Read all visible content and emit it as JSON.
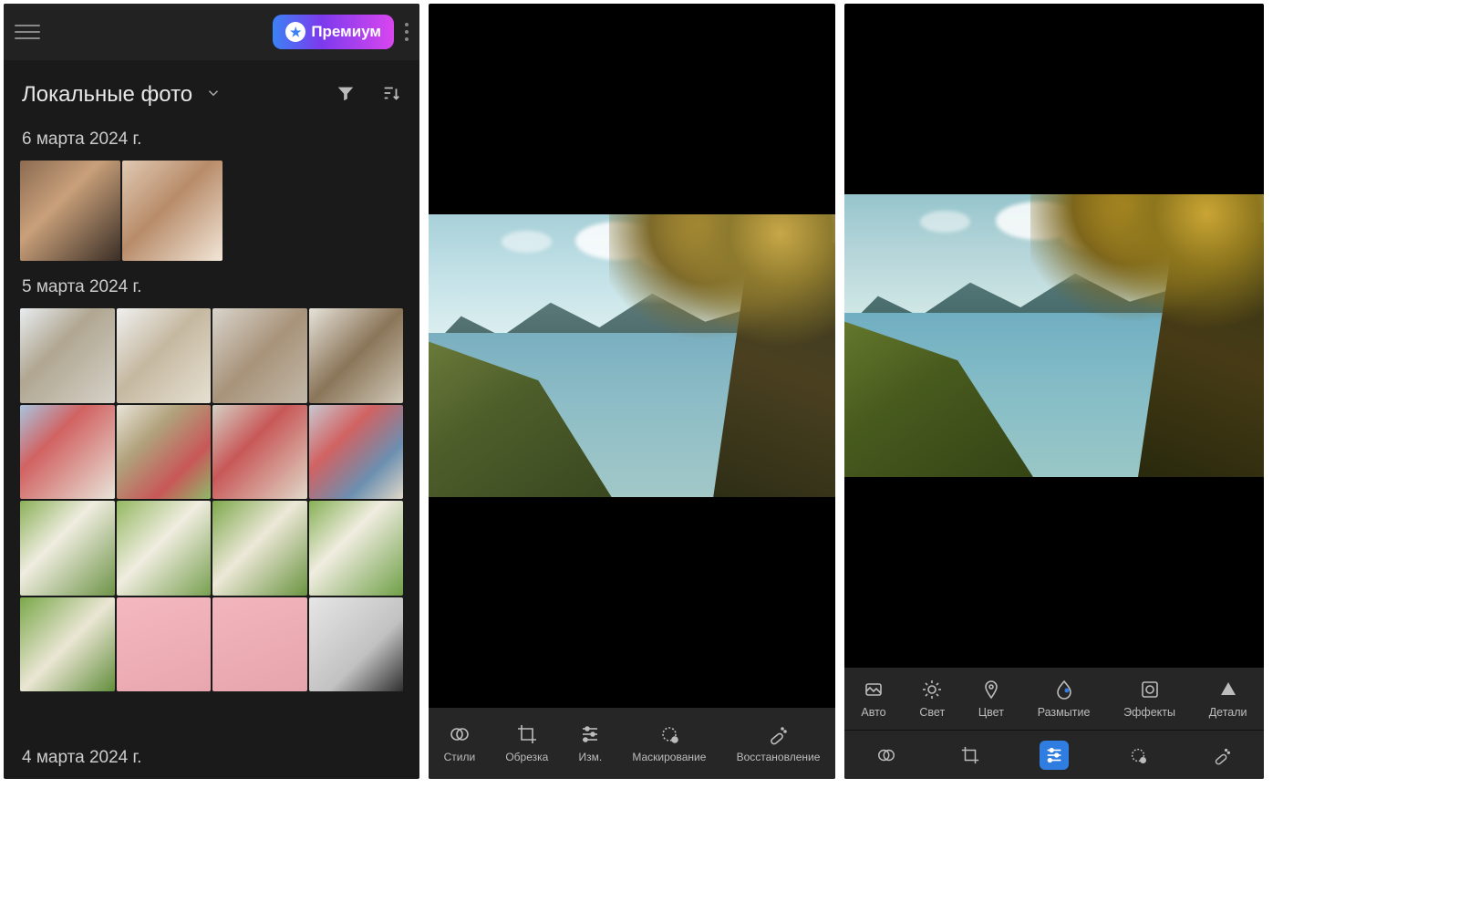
{
  "panel1": {
    "premium_label": "Премиум",
    "title": "Локальные фото",
    "dates": {
      "date1": "6 марта 2024 г.",
      "date2": "5 марта 2024 г.",
      "date3": "4 марта 2024 г."
    }
  },
  "panel2": {
    "tools": {
      "styles": "Стили",
      "crop": "Обрезка",
      "adjust": "Изм.",
      "masking": "Маскирование",
      "healing": "Восстановление"
    }
  },
  "panel3": {
    "tools": {
      "auto": "Авто",
      "light": "Свет",
      "color": "Цвет",
      "blur": "Размытие",
      "effects": "Эффекты",
      "detail": "Детали"
    }
  }
}
